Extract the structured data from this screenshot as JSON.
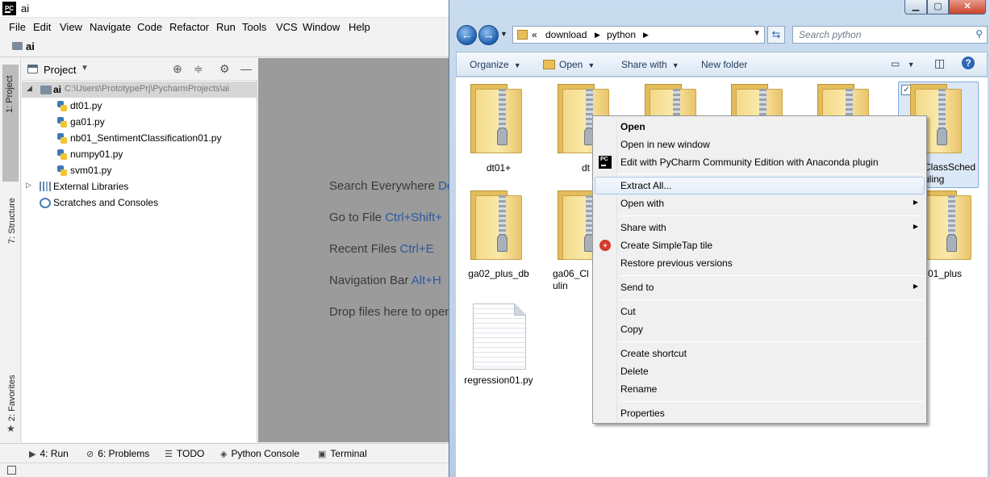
{
  "pycharm": {
    "title": "ai",
    "logo": "PC",
    "menu": [
      "File",
      "Edit",
      "View",
      "Navigate",
      "Code",
      "Refactor",
      "Run",
      "Tools",
      "VCS",
      "Window",
      "Help"
    ],
    "breadcrumb": "ai",
    "left_strip": {
      "project": "1: Project",
      "structure": "7: Structure",
      "favorites": "2: Favorites"
    },
    "project_panel": {
      "title": "Project",
      "root_name": "ai",
      "root_path": "C:\\Users\\PrototypePrj\\PycharmProjects\\ai",
      "files": [
        "dt01.py",
        "ga01.py",
        "nb01_SentimentClassification01.py",
        "numpy01.py",
        "svm01.py"
      ],
      "external_libraries": "External Libraries",
      "scratches": "Scratches and Consoles"
    },
    "editor_hints": [
      {
        "text": "Search Everywhere ",
        "key": "Do"
      },
      {
        "text": "Go to File ",
        "key": "Ctrl+Shift+"
      },
      {
        "text": "Recent Files ",
        "key": "Ctrl+E"
      },
      {
        "text": "Navigation Bar ",
        "key": "Alt+H"
      },
      {
        "text": "Drop files here to open",
        "key": ""
      }
    ],
    "bottom_tools": [
      "4: Run",
      "6: Problems",
      "TODO",
      "Python Console",
      "Terminal"
    ]
  },
  "explorer": {
    "address": {
      "history": "«",
      "segments": [
        "download",
        "python"
      ]
    },
    "search_placeholder": "Search python",
    "commands": {
      "organize": "Organize",
      "open": "Open",
      "share_with": "Share with",
      "new_folder": "New folder"
    },
    "items": [
      {
        "label": "dt01+"
      },
      {
        "label": "dt"
      },
      {
        "label": ""
      },
      {
        "label": ""
      },
      {
        "label": ""
      },
      {
        "label": "ClassSched\nuling"
      },
      {
        "label": "ga02_plus_db"
      },
      {
        "label": "ga06_Cl\nulin"
      },
      {
        "label": "01_plus"
      },
      {
        "label": "regression01.py"
      }
    ],
    "context_menu": [
      {
        "label": "Open",
        "bold": true
      },
      {
        "label": "Open in new window"
      },
      {
        "label": "Edit with PyCharm Community Edition with Anaconda plugin",
        "icon": "pycharm-icon"
      },
      {
        "label": "Extract All...",
        "highlighted": true
      },
      {
        "label": "Open with",
        "submenu": true
      },
      {
        "label": "Share with",
        "submenu": true
      },
      {
        "label": "Create SimpleTap tile",
        "icon": "simpletap-icon"
      },
      {
        "label": "Restore previous versions"
      },
      {
        "label": "Send to",
        "submenu": true
      },
      {
        "label": "Cut"
      },
      {
        "label": "Copy"
      },
      {
        "label": "Create shortcut"
      },
      {
        "label": "Delete"
      },
      {
        "label": "Rename"
      },
      {
        "label": "Properties"
      }
    ]
  }
}
